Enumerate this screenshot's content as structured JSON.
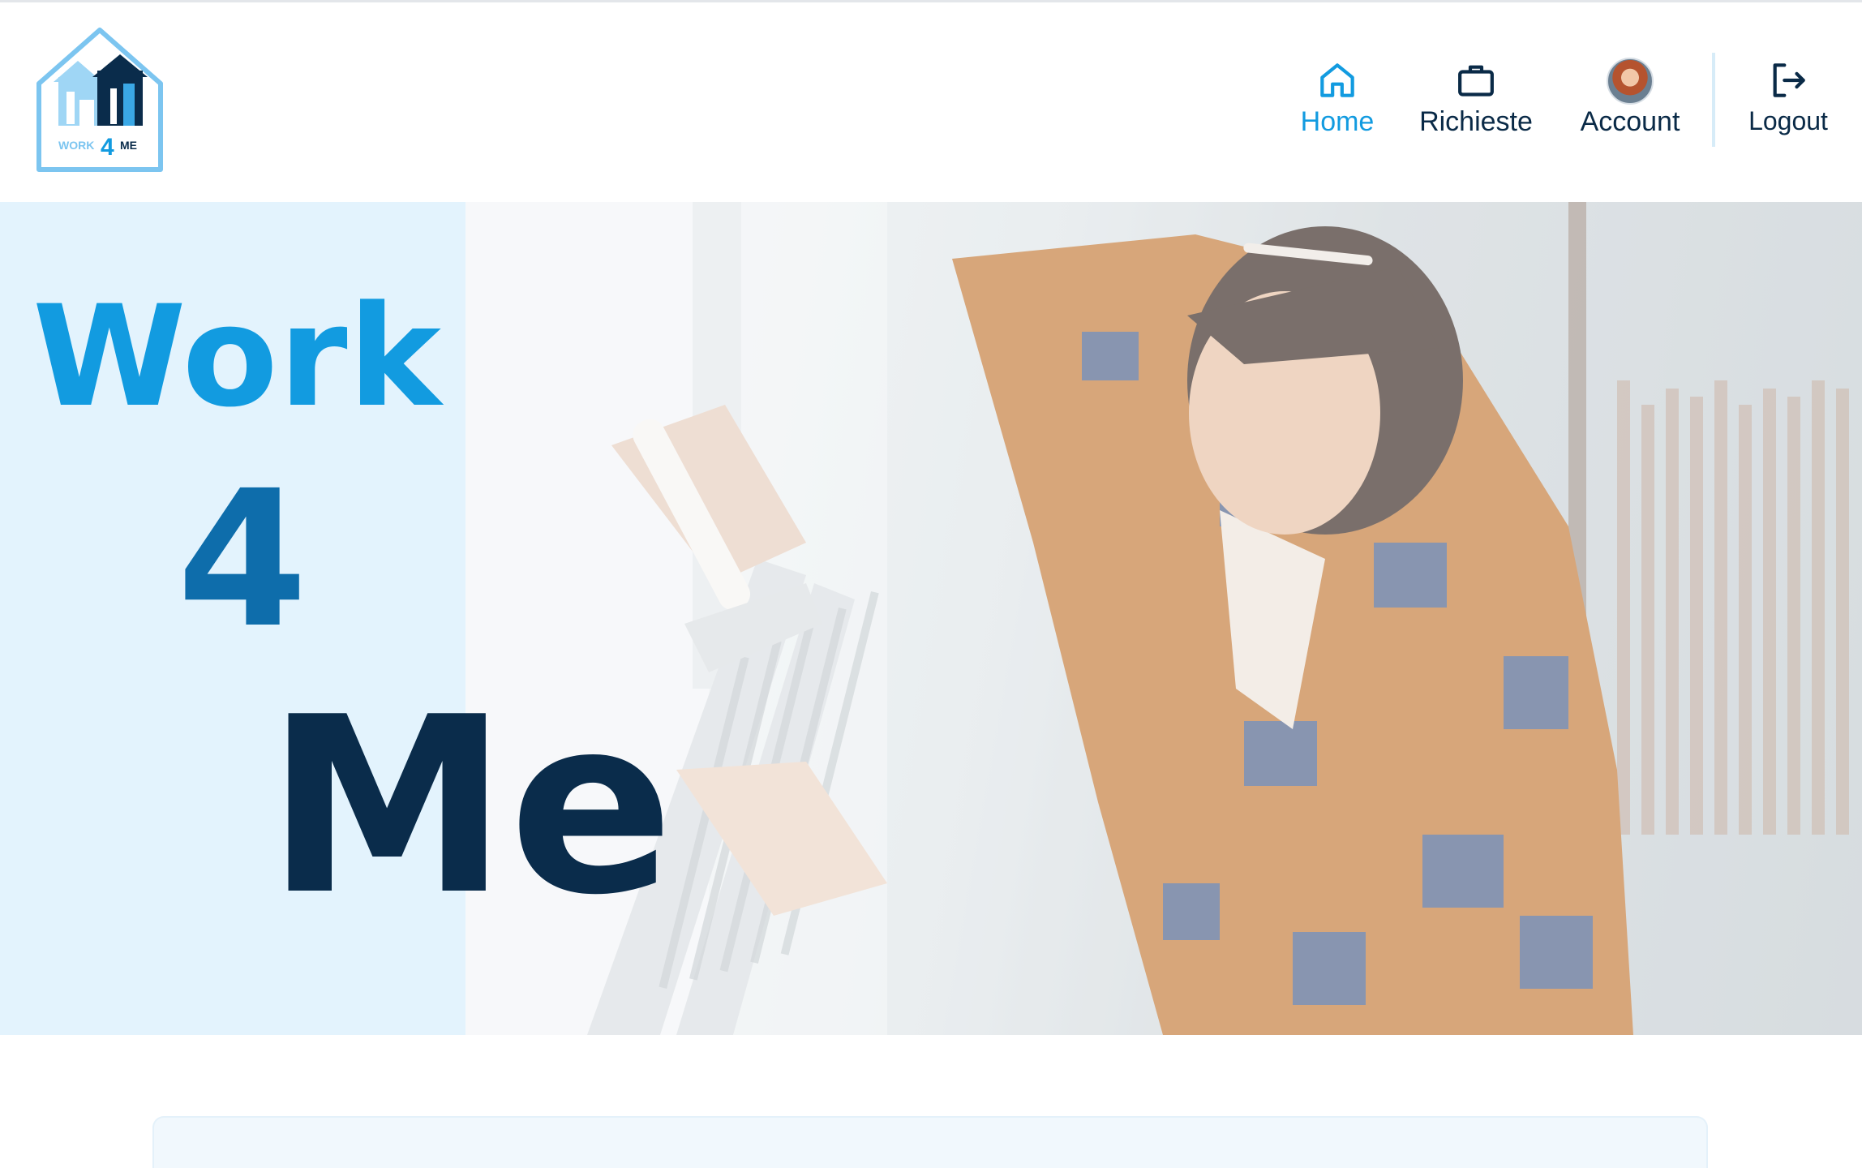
{
  "header": {
    "logo": {
      "brand_text_work": "WORK",
      "brand_text_num": "4",
      "brand_text_me": "ME"
    },
    "nav": [
      {
        "label": "Home",
        "icon": "home-icon",
        "active": true
      },
      {
        "label": "Richieste",
        "icon": "briefcase-icon",
        "active": false
      },
      {
        "label": "Account",
        "icon": "avatar",
        "active": false
      },
      {
        "label": "Logout",
        "icon": "logout-icon",
        "active": false
      }
    ]
  },
  "hero": {
    "title_line1": "Work",
    "title_line2": "4",
    "title_line3": "Me"
  },
  "colors": {
    "accent": "#129be0",
    "mid_blue": "#0e6dab",
    "navy": "#0a2c4b",
    "hero_panel": "#e3f3fd"
  }
}
